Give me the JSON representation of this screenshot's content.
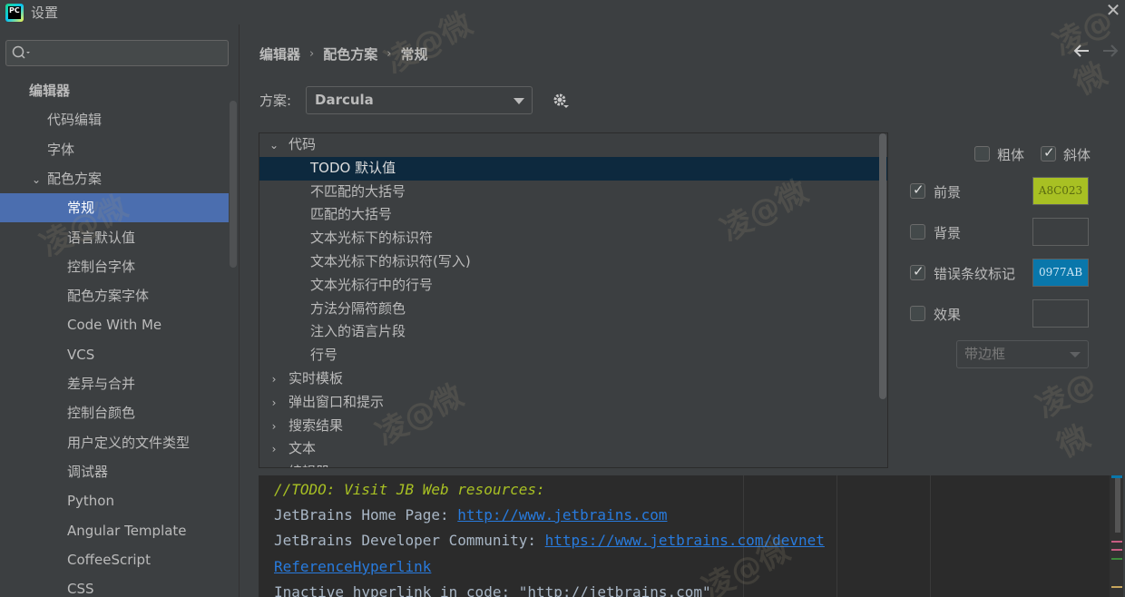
{
  "window": {
    "title": "设置",
    "app_icon_text": "PC"
  },
  "sidebar": {
    "search_placeholder": "",
    "items": [
      {
        "label": "编辑器",
        "level": 0,
        "bold": true
      },
      {
        "label": "代码编辑",
        "level": 1
      },
      {
        "label": "字体",
        "level": 1
      },
      {
        "label": "配色方案",
        "level": 1,
        "expanded": true
      },
      {
        "label": "常规",
        "level": 2,
        "selected": true
      },
      {
        "label": "语言默认值",
        "level": 2
      },
      {
        "label": "控制台字体",
        "level": 2
      },
      {
        "label": "配色方案字体",
        "level": 2
      },
      {
        "label": "Code With Me",
        "level": 2
      },
      {
        "label": "VCS",
        "level": 2
      },
      {
        "label": "差异与合并",
        "level": 2
      },
      {
        "label": "控制台颜色",
        "level": 2
      },
      {
        "label": "用户定义的文件类型",
        "level": 2
      },
      {
        "label": "调试器",
        "level": 2
      },
      {
        "label": "Python",
        "level": 2
      },
      {
        "label": "Angular Template",
        "level": 2
      },
      {
        "label": "CoffeeScript",
        "level": 2
      },
      {
        "label": "CSS",
        "level": 2
      }
    ]
  },
  "breadcrumb": [
    "编辑器",
    "配色方案",
    "常规"
  ],
  "scheme": {
    "label": "方案:",
    "value": "Darcula"
  },
  "attributes_tree": [
    {
      "label": "代码",
      "expanded": true,
      "child": false
    },
    {
      "label": "TODO 默认值",
      "child": true,
      "selected": true
    },
    {
      "label": "不匹配的大括号",
      "child": true
    },
    {
      "label": "匹配的大括号",
      "child": true
    },
    {
      "label": "文本光标下的标识符",
      "child": true
    },
    {
      "label": "文本光标下的标识符(写入)",
      "child": true
    },
    {
      "label": "文本光标行中的行号",
      "child": true
    },
    {
      "label": "方法分隔符颜色",
      "child": true
    },
    {
      "label": "注入的语言片段",
      "child": true
    },
    {
      "label": "行号",
      "child": true
    },
    {
      "label": "实时模板",
      "expanded": false,
      "child": false
    },
    {
      "label": "弹出窗口和提示",
      "expanded": false,
      "child": false
    },
    {
      "label": "搜索结果",
      "expanded": false,
      "child": false
    },
    {
      "label": "文本",
      "expanded": false,
      "child": false
    },
    {
      "label": "编辑器",
      "expanded": false,
      "child": false
    }
  ],
  "options": {
    "bold": {
      "label": "粗体",
      "checked": false
    },
    "italic": {
      "label": "斜体",
      "checked": true
    },
    "foreground": {
      "label": "前景",
      "checked": true,
      "color": "A8C023",
      "color_hex": "#a8c023"
    },
    "background": {
      "label": "背景",
      "checked": false,
      "color": ""
    },
    "error_stripe": {
      "label": "错误条纹标记",
      "checked": true,
      "color": "0977AB",
      "color_hex": "#0977ab"
    },
    "effects": {
      "label": "效果",
      "checked": false,
      "color": "",
      "type": "带边框"
    }
  },
  "preview": {
    "todo_line": "//TODO: Visit JB Web resources:",
    "line2_text": "JetBrains Home Page: ",
    "line2_link": "http://www.jetbrains.com",
    "line3_text": "JetBrains Developer Community: ",
    "line3_link": "https://www.jetbrains.com/devnet",
    "line4_link": "ReferenceHyperlink",
    "line5_text": "Inactive hyperlink in code: \"http://jetbrains.com\""
  },
  "watermark_text": "凌@微",
  "colors": {
    "selection": "#4b6eaf",
    "list_selection": "#0d293e",
    "link": "#287bde",
    "todo": "#a8c023"
  }
}
